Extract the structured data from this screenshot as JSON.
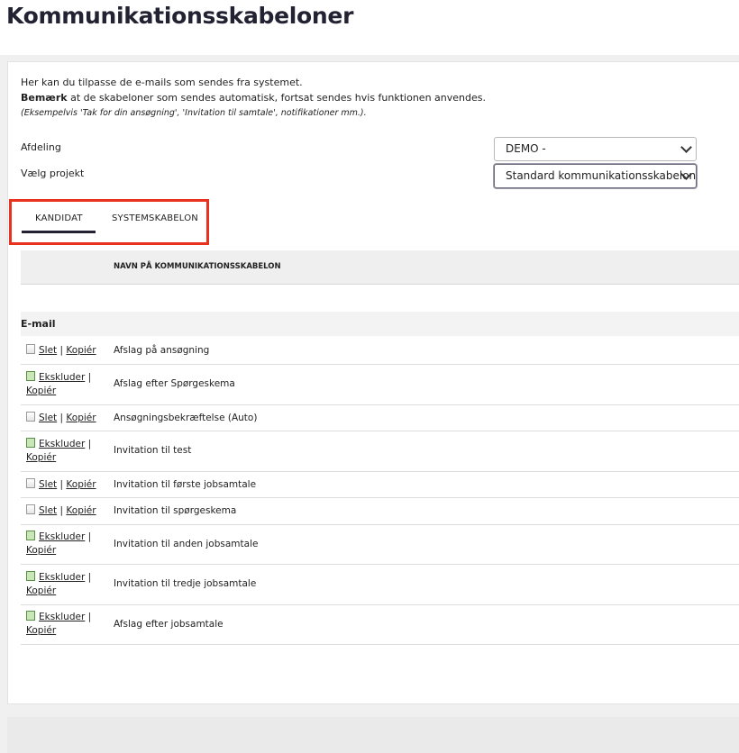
{
  "page": {
    "title": "Kommunikationsskabeloner"
  },
  "intro": {
    "line1": "Her kan du tilpasse de e-mails som sendes fra systemet.",
    "line2_bold": "Bemærk",
    "line2_rest": " at de skabeloner som sendes automatisk, fortsat sendes hvis funktionen anvendes.",
    "line3": "(Eksempelvis 'Tak for din ansøgning', 'Invitation til samtale', notifikationer mm.)."
  },
  "filters": {
    "department_label": "Afdeling",
    "department_value": "DEMO -",
    "project_label": "Vælg projekt",
    "project_value": "Standard kommunikationsskabeloner"
  },
  "tabs": [
    {
      "label": "KANDIDAT",
      "active": true
    },
    {
      "label": "SYSTEMSKABELON",
      "active": false
    }
  ],
  "table": {
    "column_header": "NAVN PÅ KOMMUNIKATIONSSKABELON",
    "group_label": "E-mail",
    "rows": [
      {
        "type": "delete",
        "action1": "Slet",
        "sep": "|",
        "action2": "Kopiér",
        "name": "Afslag på ansøgning"
      },
      {
        "type": "exclude",
        "action1": "Ekskluder",
        "sep": "|",
        "action2": "Kopiér",
        "name": "Afslag efter Spørgeskema"
      },
      {
        "type": "delete",
        "action1": "Slet",
        "sep": "|",
        "action2": "Kopiér",
        "name": "Ansøgningsbekræftelse (Auto)"
      },
      {
        "type": "exclude",
        "action1": "Ekskluder",
        "sep": "|",
        "action2": "Kopiér",
        "name": "Invitation til test"
      },
      {
        "type": "delete",
        "action1": "Slet",
        "sep": "|",
        "action2": "Kopiér",
        "name": "Invitation til første jobsamtale"
      },
      {
        "type": "delete",
        "action1": "Slet",
        "sep": "|",
        "action2": "Kopiér",
        "name": "Invitation til spørgeskema"
      },
      {
        "type": "exclude",
        "action1": "Ekskluder",
        "sep": "|",
        "action2": "Kopiér",
        "name": "Invitation til anden jobsamtale"
      },
      {
        "type": "exclude",
        "action1": "Ekskluder",
        "sep": "|",
        "action2": "Kopiér",
        "name": "Invitation til tredje jobsamtale"
      },
      {
        "type": "exclude",
        "action1": "Ekskluder",
        "sep": "|",
        "action2": "Kopiér",
        "name": "Afslag efter jobsamtale"
      }
    ]
  },
  "colors": {
    "highlight": "#e8321e",
    "tab_underline": "#222233"
  }
}
